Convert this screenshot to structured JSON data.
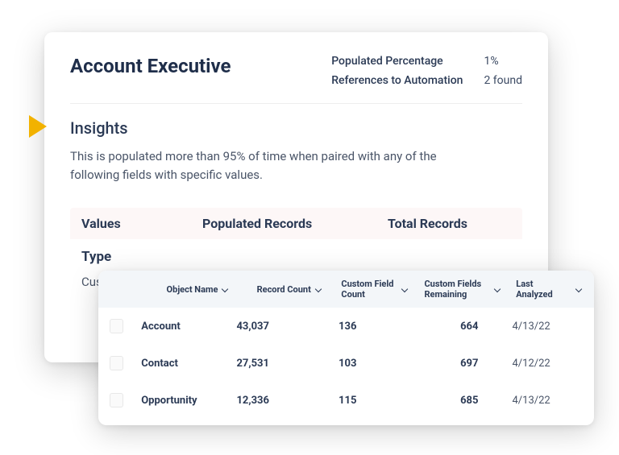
{
  "header": {
    "title": "Account Executive",
    "stats": [
      {
        "label": "Populated Percentage",
        "value": "1%"
      },
      {
        "label": "References to Automation",
        "value": "2 found"
      }
    ]
  },
  "insights": {
    "title": "Insights",
    "description": "This is populated more than 95% of time when paired with any of the following fields with specific values."
  },
  "values_table": {
    "headers": {
      "values": "Values",
      "populated": "Populated Records",
      "total": "Total Records"
    },
    "type_label": "Type",
    "partial_row": "Custo"
  },
  "front_table": {
    "columns": {
      "object_name": "Object Name",
      "record_count": "Record Count",
      "custom_field_count": "Custom Field Count",
      "custom_fields_remaining": "Custom Fields Remaining",
      "last_analyzed": "Last Analyzed"
    },
    "rows": [
      {
        "object": "Account",
        "records": "43,037",
        "cfc": "136",
        "cfr": "664",
        "last": "4/13/22"
      },
      {
        "object": "Contact",
        "records": "27,531",
        "cfc": "103",
        "cfr": "697",
        "last": "4/12/22"
      },
      {
        "object": "Opportunity",
        "records": "12,336",
        "cfc": "115",
        "cfr": "685",
        "last": "4/13/22"
      }
    ]
  }
}
